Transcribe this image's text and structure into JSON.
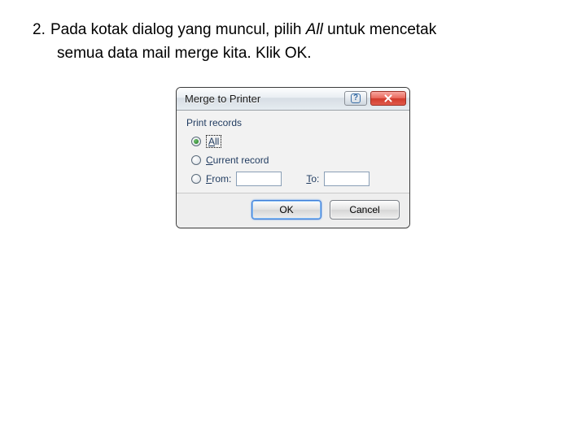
{
  "instruction": {
    "number": "2.",
    "line1_pre": "Pada kotak dialog yang muncul, pilih ",
    "line1_italic": "All",
    "line1_post": " untuk mencetak",
    "line2": "semua data mail merge kita. Klik OK."
  },
  "dialog": {
    "title": "Merge to Printer",
    "group_label": "Print records",
    "options": {
      "all_prefix": "A",
      "all_rest": "ll",
      "current_prefix": "C",
      "current_rest": "urrent record",
      "from_prefix": "F",
      "from_rest": "rom:",
      "to_prefix": "T",
      "to_rest": "o:"
    },
    "buttons": {
      "ok": "OK",
      "cancel": "Cancel"
    }
  }
}
